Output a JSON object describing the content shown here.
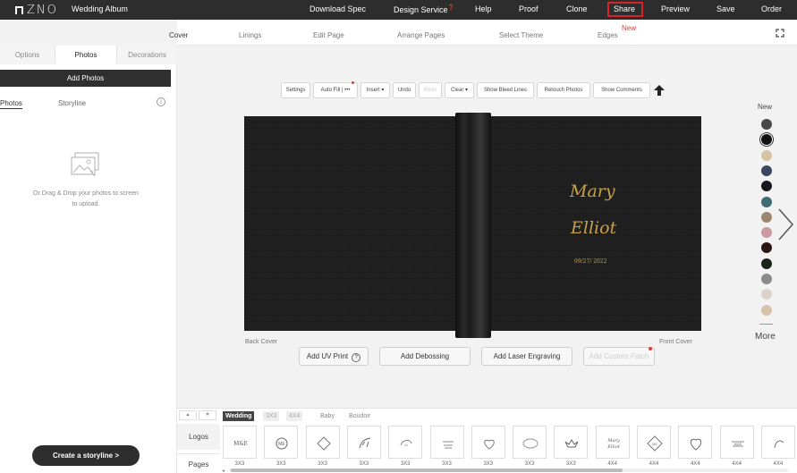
{
  "app": {
    "logo": "ZNO",
    "album_title": "Wedding Album"
  },
  "topnav": {
    "download_spec": "Download Spec",
    "design_service": "Design Service",
    "design_service_badge": "❓",
    "help": "Help",
    "proof": "Proof",
    "clone": "Clone",
    "share": "Share",
    "preview": "Preview",
    "save": "Save",
    "order": "Order"
  },
  "tabs": {
    "cover": "Cover",
    "linings": "Linings",
    "edit_page": "Edit Page",
    "arrange_pages": "Arrange Pages",
    "select_theme": "Select Theme",
    "edges": "Edges",
    "edges_badge": "New"
  },
  "left_panel": {
    "tabs": {
      "options": "Options",
      "photos": "Photos",
      "decorations": "Decorations"
    },
    "add_photos": "Add Photos",
    "sub_tabs": {
      "photos": "Photos",
      "storyline": "Storyline"
    },
    "info": "i",
    "drop_text": "Or Drag & Drop your photos to screen to upload.",
    "create_storyline": "Create a storyline >"
  },
  "toolbar": {
    "settings": "Settings",
    "auto_fill": "Auto Fill | •••",
    "insert": "Insert ▾",
    "undo": "Undo",
    "redo": "Redo",
    "clear": "Clear ▾",
    "show_bleed": "Show Bleed Lines",
    "retouch": "Retouch Photos",
    "show_comments": "Show Comments"
  },
  "cover": {
    "name1": "Mary",
    "name2": "Elliot",
    "date": "09/27/ 2022",
    "back_label": "Back Cover",
    "front_label": "Front Cover",
    "add_uv_print": "Add UV Print",
    "help_mark": "?",
    "add_debossing": "Add Debossing",
    "add_laser": "Add Laser Engraving",
    "add_patch": "Add Custom Patch"
  },
  "swatches": {
    "title": "New",
    "more": "More",
    "colors": [
      "#4a4a4a",
      "#111111",
      "#d9c3a5",
      "#3b4760",
      "#15181d",
      "#3e6b74",
      "#9b8670",
      "#c99aa0",
      "#2a1616",
      "#1d2419",
      "#8b8b8b",
      "#d9d3c8",
      "#d8c2ac"
    ],
    "selected_index": 1
  },
  "bottom": {
    "pager_up": "▴",
    "pager_down": "▾",
    "categories": {
      "wedding": "Wedding",
      "size3": "3X3",
      "size4": "4X4",
      "baby": "Baby",
      "boudoir": "Boudoir"
    },
    "logos": "Logos",
    "pages": "Pages",
    "thumb_labels": [
      "3X3",
      "3X3",
      "3X3",
      "3X3",
      "3X3",
      "3X3",
      "3X3",
      "3X3",
      "3X3",
      "4X4",
      "4X4",
      "4X4",
      "4X4",
      "4X4"
    ],
    "scroll_left": "◂"
  }
}
